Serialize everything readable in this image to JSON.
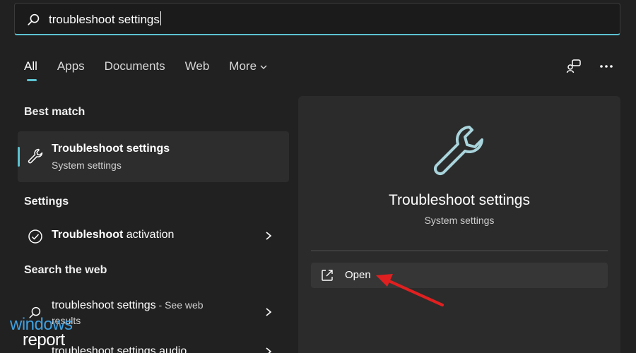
{
  "search": {
    "value": "troubleshoot settings",
    "icon": "search-icon"
  },
  "tabs": [
    {
      "label": "All",
      "active": true
    },
    {
      "label": "Apps"
    },
    {
      "label": "Documents"
    },
    {
      "label": "Web"
    },
    {
      "label": "More"
    }
  ],
  "top_right_icons": [
    "feedback-icon",
    "more-options-icon"
  ],
  "sections": {
    "best_match": "Best match",
    "settings": "Settings",
    "search_web": "Search the web"
  },
  "best_match": {
    "title": "Troubleshoot settings",
    "subtitle": "System settings",
    "icon": "wrench-icon"
  },
  "settings_items": [
    {
      "bold": "Troubleshoot",
      "rest": " activation",
      "icon": "check-circle-icon"
    }
  ],
  "web_items": [
    {
      "text": "troubleshoot settings",
      "suffix": " - See web",
      "line2": "results",
      "icon": "search-icon"
    },
    {
      "text": "troubleshoot settings audio",
      "icon": "search-icon"
    }
  ],
  "preview": {
    "title": "Troubleshoot settings",
    "subtitle": "System settings",
    "open_label": "Open"
  },
  "watermark": {
    "line1": "windows",
    "line2": "report"
  },
  "colors": {
    "accent": "#5cc2d1",
    "background": "#212121",
    "panel": "#2b2b2b",
    "arrow": "#e02020",
    "watermark_blue": "#3fa0e0"
  }
}
